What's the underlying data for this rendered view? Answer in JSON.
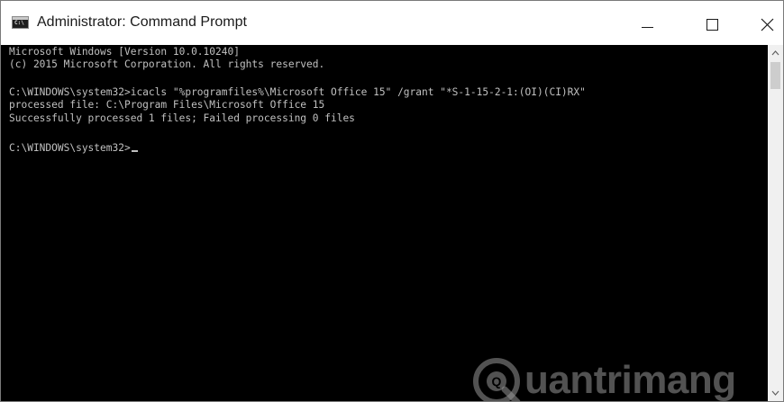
{
  "window": {
    "title": "Administrator: Command Prompt",
    "app_icon_text": "C:\\",
    "controls": {
      "minimize": "minimize-icon",
      "maximize": "maximize-icon",
      "close": "close-icon"
    }
  },
  "console": {
    "lines": [
      "Microsoft Windows [Version 10.0.10240]",
      "(c) 2015 Microsoft Corporation. All rights reserved.",
      "",
      "C:\\WINDOWS\\system32>icacls \"%programfiles%\\Microsoft Office 15\" /grant \"*S-1-15-2-1:(OI)(CI)RX\"",
      "processed file: C:\\Program Files\\Microsoft Office 15",
      "Successfully processed 1 files; Failed processing 0 files",
      "",
      "C:\\WINDOWS\\system32>"
    ],
    "colors": {
      "background": "#000000",
      "foreground": "#c0c0c0"
    }
  },
  "watermark": {
    "text": "uantrimang",
    "logo_letter": "Q"
  },
  "scrollbar": {
    "up_icon": "scroll-up-arrow-icon",
    "down_icon": "scroll-down-arrow-icon"
  }
}
